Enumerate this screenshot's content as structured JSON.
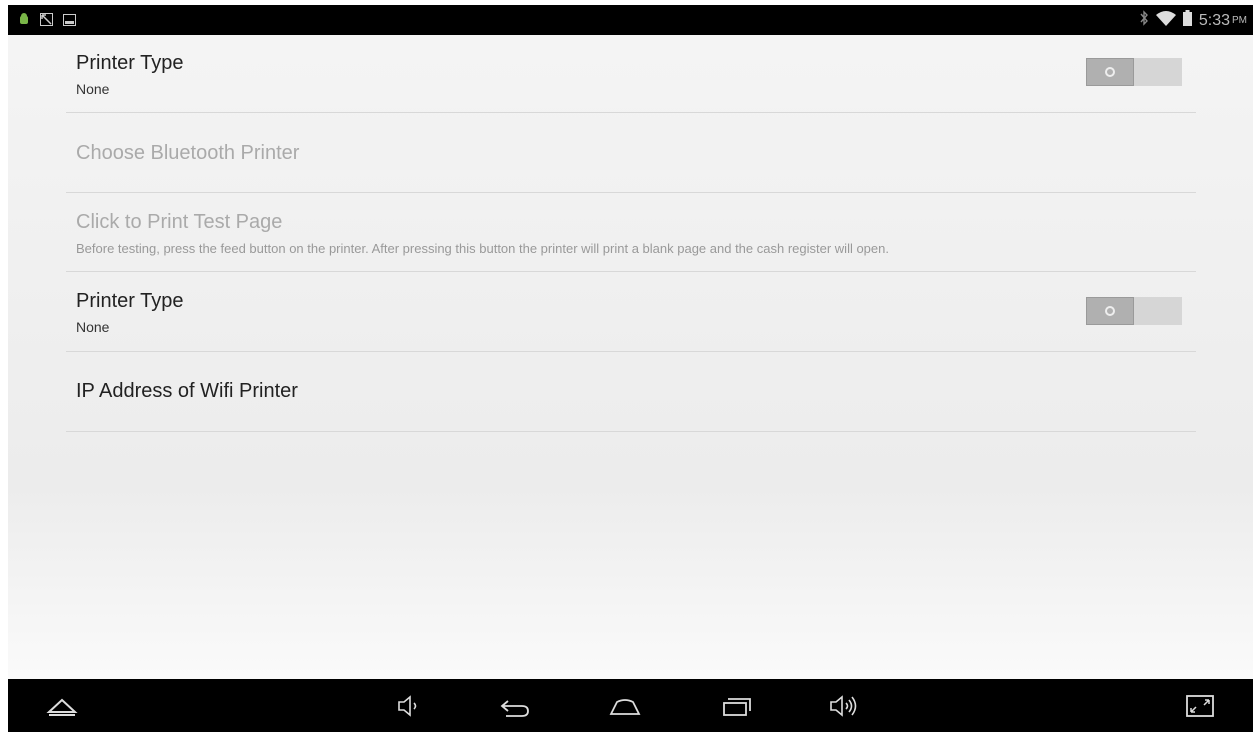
{
  "status_bar": {
    "time": "5:33",
    "ampm": "PM",
    "icons": [
      "android-debug-icon",
      "screenshot-icon",
      "gallery-icon",
      "bluetooth-icon",
      "wifi-icon",
      "battery-icon"
    ]
  },
  "preferences": [
    {
      "title": "Printer Type",
      "summary": "None",
      "enabled": true,
      "toggle": false
    },
    {
      "title": "Choose Bluetooth Printer",
      "summary": "",
      "enabled": false
    },
    {
      "title": "Click to Print Test Page",
      "summary": "Before testing, press the feed button on the printer. After pressing this button the printer will print a blank page and the cash register will open.",
      "enabled": false
    },
    {
      "title": "Printer Type",
      "summary": "None",
      "enabled": true,
      "toggle": false
    },
    {
      "title": "IP Address of Wifi Printer",
      "summary": "",
      "enabled": true
    }
  ],
  "nav_bar": {
    "buttons": [
      "hide-nav-icon",
      "volume-down-icon",
      "back-icon",
      "home-icon",
      "recents-icon",
      "volume-up-icon",
      "screenshot-resize-icon"
    ]
  },
  "colors": {
    "bars": "#000000",
    "background": "#f2f2f2",
    "divider": "#d8d8d8",
    "disabled_text": "#aaaaaa"
  }
}
